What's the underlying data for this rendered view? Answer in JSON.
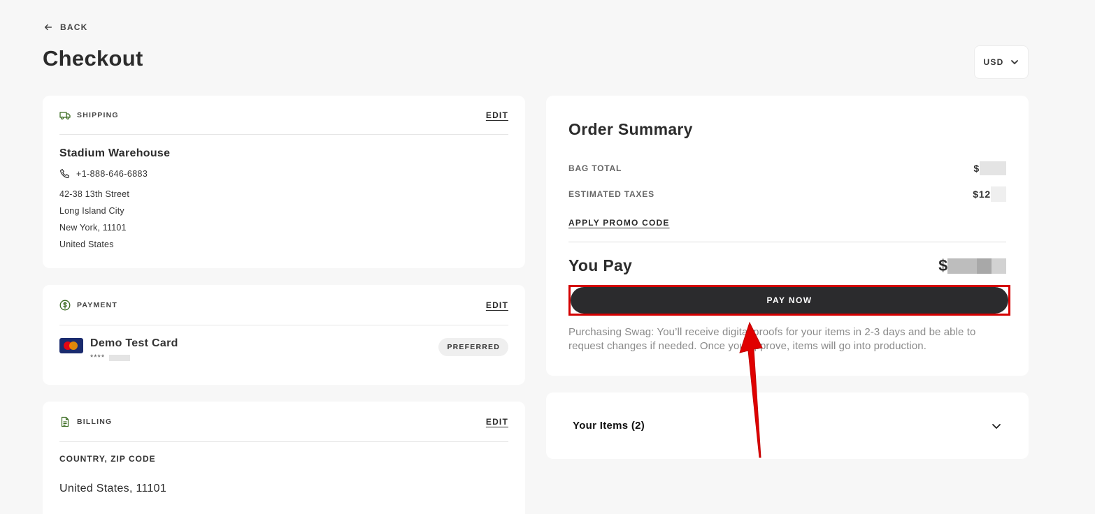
{
  "nav": {
    "back_label": "BACK"
  },
  "page": {
    "title": "Checkout"
  },
  "currency": {
    "selected": "USD"
  },
  "shipping": {
    "section_label": "SHIPPING",
    "edit_label": "EDIT",
    "name": "Stadium Warehouse",
    "phone": "+1-888-646-6883",
    "address_lines": [
      "42-38 13th Street",
      "Long Island City",
      "New York, 11101",
      "United States"
    ]
  },
  "payment": {
    "section_label": "PAYMENT",
    "edit_label": "EDIT",
    "card_name": "Demo Test Card",
    "card_mask": "****",
    "badge": "PREFERRED"
  },
  "billing": {
    "section_label": "BILLING",
    "edit_label": "EDIT",
    "field_label": "COUNTRY, ZIP CODE",
    "value": "United States, 11101"
  },
  "summary": {
    "title": "Order Summary",
    "bag_total_label": "BAG TOTAL",
    "bag_total_value": "$",
    "taxes_label": "ESTIMATED TAXES",
    "taxes_value": "$12",
    "promo_label": "APPLY PROMO CODE",
    "you_pay_label": "You Pay",
    "you_pay_value": "$",
    "pay_button_label": "PAY NOW",
    "note": "Purchasing Swag: You’ll receive digital proofs for your items in 2-3 days and be able to request changes if needed. Once you approve, items will go into production."
  },
  "items": {
    "title": "Your Items (2)"
  },
  "colors": {
    "highlight": "#d40000",
    "button": "#2b2b2d",
    "accent_icon": "#3a6b1f"
  }
}
